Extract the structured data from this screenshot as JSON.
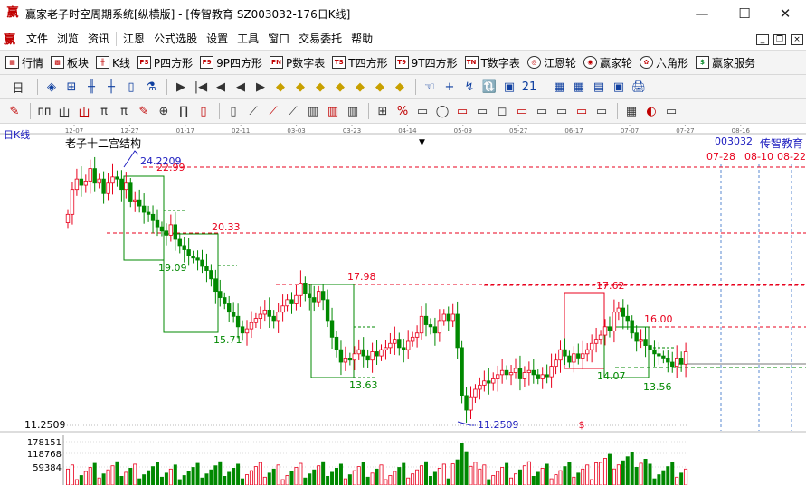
{
  "window": {
    "title": "赢家老子时空周期系统[纵横版] - [传智教育  SZ003032-176日K线]",
    "min_label": "—",
    "max_label": "☐",
    "close_label": "✕"
  },
  "menu": {
    "logo": "赢",
    "items": [
      "文件",
      "浏览",
      "资讯",
      "江恩",
      "公式选股",
      "设置",
      "工具",
      "窗口",
      "交易委托",
      "帮助"
    ],
    "mdi": [
      "_",
      "❐",
      "×"
    ]
  },
  "toolbar1": {
    "items": [
      {
        "icon": "grid-icon",
        "glyph": "▦",
        "label": "行情"
      },
      {
        "icon": "blocks-icon",
        "glyph": "▩",
        "label": "板块"
      },
      {
        "icon": "kline-icon",
        "glyph": "╫",
        "label": "K线"
      },
      {
        "icon": "p-square-icon",
        "glyph": "PS",
        "label": "P四方形"
      },
      {
        "icon": "9p-square-icon",
        "glyph": "P9",
        "label": "9P四方形"
      },
      {
        "icon": "p-number-icon",
        "glyph": "PN",
        "label": "P数字表"
      },
      {
        "icon": "t-square-icon",
        "glyph": "TS",
        "label": "T四方形"
      },
      {
        "icon": "9t-square-icon",
        "glyph": "T9",
        "label": "9T四方形"
      },
      {
        "icon": "t-number-icon",
        "glyph": "TN",
        "label": "T数字表"
      },
      {
        "icon": "gann-wheel-icon",
        "glyph": "◎",
        "label": "江恩轮"
      },
      {
        "icon": "winner-wheel-icon",
        "glyph": "◉",
        "label": "赢家轮"
      },
      {
        "icon": "hexagon-icon",
        "glyph": "✿",
        "label": "六角形"
      },
      {
        "icon": "dollar-icon",
        "glyph": "$",
        "label": "赢家服务"
      }
    ]
  },
  "toolbar2": {
    "period": "日",
    "glyphs": [
      "◈",
      "⊞",
      "╫",
      "┼",
      "▯",
      "⚗",
      "▶",
      "|◀",
      "◀",
      "◀",
      "▶",
      "◆",
      "◆",
      "◆",
      "◆",
      "◆",
      "◆",
      "◆",
      "☜",
      "+",
      "↯",
      "🔃",
      "▣",
      "21",
      "▦",
      "▦",
      "▤",
      "▣",
      "🖨"
    ]
  },
  "toolbar3": {
    "glyphs": [
      "✎",
      "ᴨᴨ",
      "山",
      "山",
      "π",
      "π",
      "✎",
      "⊕",
      "∏",
      "▯",
      "▯",
      "⟋",
      "⟋",
      "⟋",
      "▥",
      "▥",
      "▥",
      "⊞",
      "%",
      "▭",
      "◯",
      "▭",
      "▭",
      "◻",
      "▭",
      "▭",
      "▭",
      "▭",
      "▭",
      "▦",
      "◐",
      "▭"
    ]
  },
  "chart": {
    "period_label": "日K线",
    "indicator_label": "老子十二宫结构",
    "stock_code": "003032",
    "stock_name": "传智教育",
    "x_ticks": [
      "12-07",
      "12-27",
      "01-17",
      "02-11",
      "03-03",
      "03-23",
      "04-14",
      "05-09",
      "05-27",
      "06-17",
      "07-07",
      "07-27",
      "08-16"
    ],
    "future_dates": [
      "07-28",
      "08-10",
      "08-22"
    ],
    "low_axis_label": "11.2509",
    "volume_axis_labels": [
      "178151",
      "118768",
      "59384"
    ],
    "price_labels": {
      "high_top": "24.2209",
      "r1": "22.99",
      "r2": "20.33",
      "r3": "17.98",
      "r4": "17.62",
      "r5": "16.00",
      "g1": "19.09",
      "g2": "15.71",
      "g3": "13.63",
      "g4": "14.07",
      "g5": "13.56",
      "low_bottom": "11.2509"
    },
    "dollar_marker": "$",
    "colors": {
      "up": "#e8001c",
      "down": "#008800",
      "resist": "#e8001c",
      "support": "#008800",
      "future": "#5a8ad0",
      "blue_text": "#2020c0"
    }
  },
  "chart_data": {
    "type": "candlestick",
    "title": "老子十二宫结构",
    "y_range_price": [
      11.2509,
      24.2209
    ],
    "resistance_levels": [
      22.99,
      20.33,
      17.98,
      17.62,
      16.0
    ],
    "support_levels": [
      19.09,
      15.71,
      13.63,
      14.07,
      13.56
    ],
    "series": [
      {
        "name": "日K线",
        "period": "12-07 to 07-27",
        "open": [
          20.9,
          21.3,
          22.5,
          23.0,
          22.7,
          22.9,
          23.5,
          22.8,
          23.0,
          22.3,
          22.8,
          23.1,
          23.0,
          22.5,
          22.8,
          21.9,
          22.0,
          21.7,
          21.4,
          21.3,
          21.0,
          20.7,
          20.5,
          20.3,
          20.8,
          20.1,
          19.8,
          19.6,
          19.3,
          19.2,
          19.1,
          18.8,
          18.6,
          18.2,
          17.6,
          17.3,
          17.0,
          16.6,
          16.4,
          15.9,
          15.6,
          15.8,
          16.1,
          16.3,
          16.5,
          16.7,
          16.4,
          16.2,
          16.6,
          16.9,
          17.2,
          17.0,
          17.4,
          18.0,
          17.5,
          17.3,
          17.1,
          17.6,
          17.2,
          16.2,
          15.4,
          14.8,
          14.2,
          14.4,
          14.3,
          14.6,
          14.8,
          14.5,
          14.3,
          14.7,
          14.5,
          14.8,
          14.9,
          15.1,
          15.3,
          14.9,
          14.8,
          15.2,
          15.4,
          15.6,
          16.4,
          16.0,
          15.9,
          15.6,
          16.2,
          16.5,
          16.2,
          16.5,
          14.9,
          12.6,
          11.9,
          12.5,
          12.9,
          13.1,
          13.3,
          13.2,
          13.4,
          13.6,
          13.8,
          13.6,
          13.7,
          13.9,
          13.4,
          13.7,
          13.8,
          13.6,
          13.4,
          13.6,
          13.5,
          14.0,
          14.3,
          14.8,
          14.5,
          14.2,
          14.6,
          14.4,
          14.6,
          14.8,
          15.1,
          15.3,
          15.5,
          15.9,
          15.7,
          16.6,
          16.8,
          16.4,
          16.2,
          15.6,
          15.2,
          15.3,
          15.0,
          14.8,
          14.6,
          14.5,
          14.4,
          14.2,
          14.0,
          14.4,
          14.1
        ],
        "close": [
          21.3,
          22.5,
          23.0,
          22.7,
          22.9,
          23.5,
          22.8,
          23.0,
          22.3,
          22.8,
          23.1,
          23.0,
          22.5,
          22.8,
          21.9,
          22.0,
          21.7,
          21.4,
          21.3,
          21.0,
          20.7,
          20.5,
          20.3,
          20.8,
          20.1,
          19.8,
          19.6,
          19.3,
          19.2,
          19.1,
          18.8,
          18.6,
          18.2,
          17.6,
          17.3,
          17.0,
          16.6,
          16.4,
          15.9,
          15.6,
          15.8,
          16.1,
          16.3,
          16.5,
          16.7,
          16.4,
          16.2,
          16.6,
          16.9,
          17.2,
          17.0,
          17.4,
          18.0,
          17.5,
          17.3,
          17.1,
          17.6,
          17.2,
          16.2,
          15.4,
          14.8,
          14.2,
          14.4,
          14.3,
          14.6,
          14.8,
          14.5,
          14.3,
          14.7,
          14.5,
          14.8,
          14.9,
          15.1,
          15.3,
          14.9,
          14.8,
          15.2,
          15.4,
          15.6,
          16.4,
          16.0,
          15.9,
          15.6,
          16.2,
          16.5,
          16.2,
          16.5,
          14.9,
          12.6,
          11.9,
          12.5,
          12.9,
          13.1,
          13.3,
          13.2,
          13.4,
          13.6,
          13.8,
          13.6,
          13.7,
          13.9,
          13.4,
          13.7,
          13.8,
          13.6,
          13.4,
          13.6,
          13.5,
          14.0,
          14.3,
          14.8,
          14.5,
          14.2,
          14.6,
          14.4,
          14.6,
          14.8,
          15.1,
          15.3,
          15.5,
          15.9,
          15.7,
          16.6,
          16.8,
          16.4,
          16.2,
          15.6,
          15.2,
          15.3,
          15.0,
          14.8,
          14.6,
          14.5,
          14.4,
          14.2,
          14.0,
          14.4,
          14.1,
          14.7
        ]
      }
    ],
    "volume": {
      "ticks": [
        178151,
        118768,
        59384
      ]
    }
  }
}
